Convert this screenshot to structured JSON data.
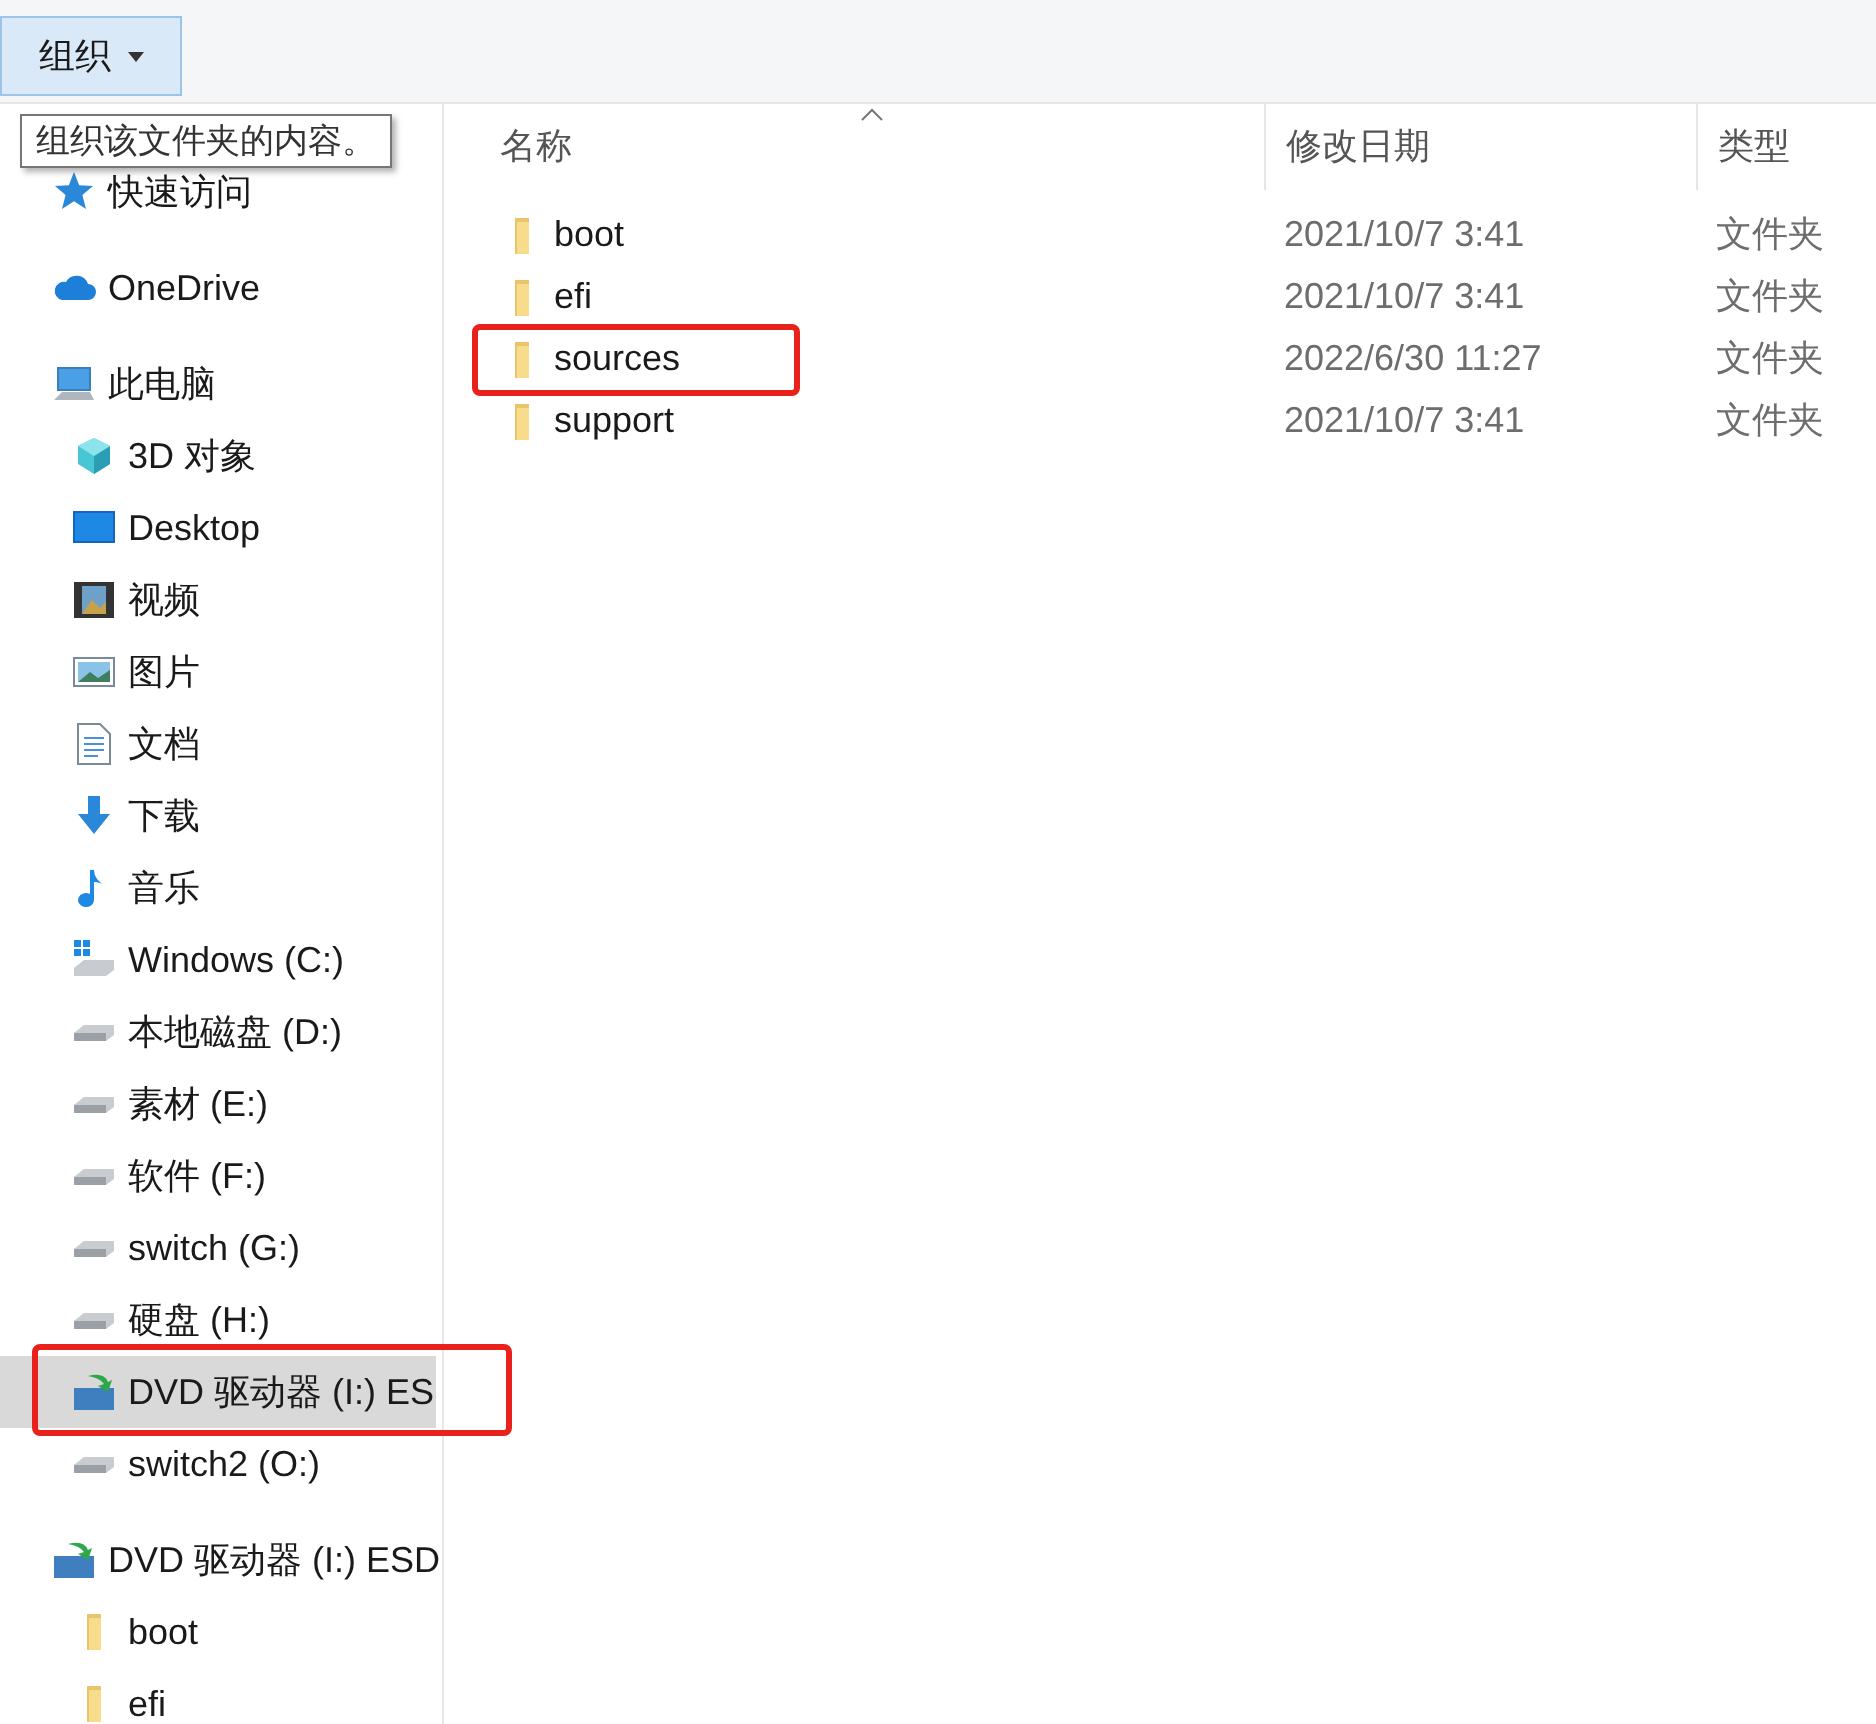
{
  "toolbar": {
    "organize_button": "组织"
  },
  "tooltip": "组织该文件夹的内容。",
  "nav": [
    {
      "label": "快速访问",
      "selected": false,
      "annotated": false
    },
    {
      "label": "OneDrive",
      "selected": false,
      "annotated": false
    },
    {
      "label": "此电脑",
      "selected": false,
      "annotated": false,
      "children": [
        {
          "label": "3D 对象",
          "selected": false,
          "annotated": false
        },
        {
          "label": "Desktop",
          "selected": false,
          "annotated": false
        },
        {
          "label": "视频",
          "selected": false,
          "annotated": false
        },
        {
          "label": "图片",
          "selected": false,
          "annotated": false
        },
        {
          "label": "文档",
          "selected": false,
          "annotated": false
        },
        {
          "label": "下载",
          "selected": false,
          "annotated": false
        },
        {
          "label": "音乐",
          "selected": false,
          "annotated": false
        },
        {
          "label": "Windows (C:)",
          "selected": false,
          "annotated": false
        },
        {
          "label": "本地磁盘 (D:)",
          "selected": false,
          "annotated": false
        },
        {
          "label": "素材 (E:)",
          "selected": false,
          "annotated": false
        },
        {
          "label": "软件 (F:)",
          "selected": false,
          "annotated": false
        },
        {
          "label": "switch (G:)",
          "selected": false,
          "annotated": false
        },
        {
          "label": "硬盘 (H:)",
          "selected": false,
          "annotated": false
        },
        {
          "label": "DVD 驱动器 (I:) ES",
          "selected": true,
          "annotated": true
        },
        {
          "label": "switch2 (O:)",
          "selected": false,
          "annotated": false
        }
      ]
    },
    {
      "label": "DVD 驱动器 (I:) ESD",
      "selected": false,
      "annotated": false,
      "children": [
        {
          "label": "boot",
          "selected": false,
          "annotated": false
        },
        {
          "label": "efi",
          "selected": false,
          "annotated": false
        }
      ]
    }
  ],
  "columns": [
    "名称",
    "修改日期",
    "类型"
  ],
  "rows": [
    {
      "name": "boot",
      "date": "2021/10/7 3:41",
      "type": "文件夹",
      "annotated": false
    },
    {
      "name": "efi",
      "date": "2021/10/7 3:41",
      "type": "文件夹",
      "annotated": false
    },
    {
      "name": "sources",
      "date": "2022/6/30 11:27",
      "type": "文件夹",
      "annotated": true
    },
    {
      "name": "support",
      "date": "2021/10/7 3:41",
      "type": "文件夹",
      "annotated": false
    }
  ]
}
